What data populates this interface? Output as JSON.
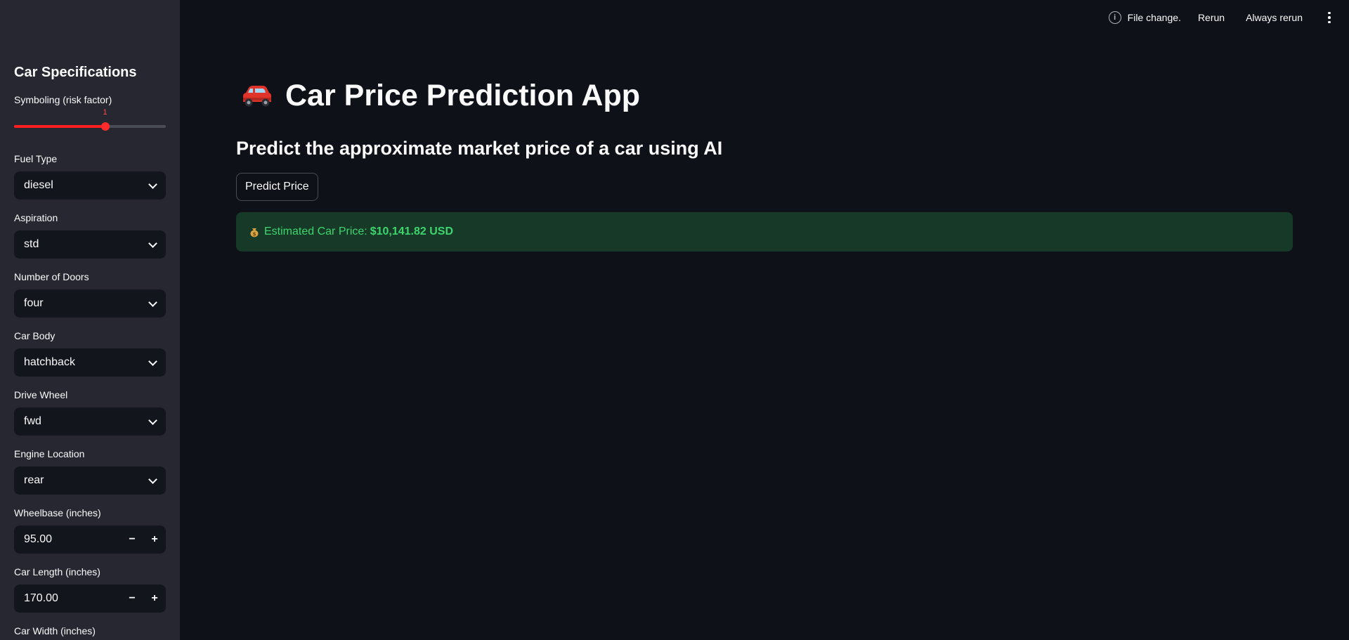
{
  "toolbar": {
    "status_text": "File change.",
    "rerun_label": "Rerun",
    "always_rerun_label": "Always rerun"
  },
  "sidebar": {
    "title": "Car Specifications",
    "symboling": {
      "label": "Symboling (risk factor)",
      "value": "1",
      "position_fraction": 0.6
    },
    "fuel_type": {
      "label": "Fuel Type",
      "value": "diesel"
    },
    "aspiration": {
      "label": "Aspiration",
      "value": "std"
    },
    "doors": {
      "label": "Number of Doors",
      "value": "four"
    },
    "car_body": {
      "label": "Car Body",
      "value": "hatchback"
    },
    "drive_wheel": {
      "label": "Drive Wheel",
      "value": "fwd"
    },
    "engine_location": {
      "label": "Engine Location",
      "value": "rear"
    },
    "wheelbase": {
      "label": "Wheelbase (inches)",
      "value": "95.00"
    },
    "car_length": {
      "label": "Car Length (inches)",
      "value": "170.00"
    },
    "car_width": {
      "label": "Car Width (inches)"
    },
    "stepper": {
      "minus": "−",
      "plus": "+"
    }
  },
  "main": {
    "title": "Car Price Prediction App",
    "subtitle": "Predict the approximate market price of a car using AI",
    "predict_button": "Predict Price",
    "result_label": "Estimated Car Price:",
    "result_value": "$10,141.82 USD"
  },
  "colors": {
    "accent": "#ff4b4b",
    "success_bg": "#173928",
    "success_text": "#3dd56d",
    "sidebar_bg": "#262730",
    "app_bg": "#0e1117"
  }
}
